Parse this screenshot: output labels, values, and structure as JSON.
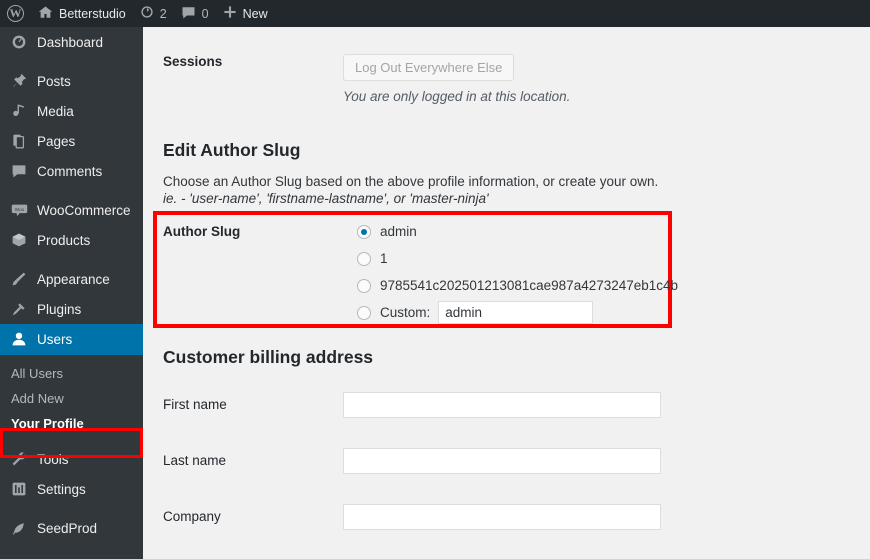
{
  "adminbar": {
    "logo_icon": "wordpress-logo-icon",
    "site_name": "Betterstudio",
    "home_icon": "home-icon",
    "updates_icon": "updates-icon",
    "updates_count": "2",
    "comments_icon": "comment-bubble-icon",
    "comments_count": "0",
    "new_icon": "plus-icon",
    "new_label": "New"
  },
  "sidebar": {
    "items": [
      {
        "label": "Dashboard",
        "icon": "dashboard-icon",
        "name": "sidebar-item-dashboard",
        "sep": false,
        "current": false
      },
      {
        "label": "Posts",
        "icon": "pin-icon",
        "name": "sidebar-item-posts",
        "sep": true,
        "current": false
      },
      {
        "label": "Media",
        "icon": "media-icon",
        "name": "sidebar-item-media",
        "sep": false,
        "current": false
      },
      {
        "label": "Pages",
        "icon": "pages-icon",
        "name": "sidebar-item-pages",
        "sep": false,
        "current": false
      },
      {
        "label": "Comments",
        "icon": "comment-bubble-icon",
        "name": "sidebar-item-comments",
        "sep": false,
        "current": false
      },
      {
        "label": "WooCommerce",
        "icon": "woocommerce-icon",
        "name": "sidebar-item-woocommerce",
        "sep": true,
        "current": false
      },
      {
        "label": "Products",
        "icon": "products-box-icon",
        "name": "sidebar-item-products",
        "sep": false,
        "current": false
      },
      {
        "label": "Appearance",
        "icon": "paintbrush-icon",
        "name": "sidebar-item-appearance",
        "sep": true,
        "current": false
      },
      {
        "label": "Plugins",
        "icon": "plug-icon",
        "name": "sidebar-item-plugins",
        "sep": false,
        "current": false
      },
      {
        "label": "Users",
        "icon": "user-icon",
        "name": "sidebar-item-users",
        "sep": false,
        "current": true
      }
    ],
    "submenu": [
      {
        "label": "All Users",
        "name": "submenu-item-all-users",
        "current": false
      },
      {
        "label": "Add New",
        "name": "submenu-item-add-new",
        "current": false
      },
      {
        "label": "Your Profile",
        "name": "submenu-item-your-profile",
        "current": true
      }
    ],
    "items_after": [
      {
        "label": "Tools",
        "icon": "wrench-icon",
        "name": "sidebar-item-tools",
        "sep": false,
        "current": false
      },
      {
        "label": "Settings",
        "icon": "settings-sliders-icon",
        "name": "sidebar-item-settings",
        "sep": false,
        "current": false
      },
      {
        "label": "SeedProd",
        "icon": "seedprod-icon",
        "name": "sidebar-item-seedprod",
        "sep": true,
        "current": false
      }
    ]
  },
  "main": {
    "sessions": {
      "label": "Sessions",
      "button_label": "Log Out Everywhere Else",
      "hint": "You are only logged in at this location."
    },
    "author_slug": {
      "heading": "Edit Author Slug",
      "desc_line1": "Choose an Author Slug based on the above profile information, or create your own.",
      "desc_line2": "ie. - 'user-name', 'firstname-lastname', or 'master-ninja'",
      "field_label": "Author Slug",
      "options": [
        {
          "label": "admin",
          "checked": true,
          "name": "radio-slug-admin"
        },
        {
          "label": "1",
          "checked": false,
          "name": "radio-slug-1"
        },
        {
          "label": "9785541c202501213081cae987a4273247eb1c4b",
          "checked": false,
          "name": "radio-slug-hash"
        }
      ],
      "custom": {
        "label": "Custom:",
        "checked": false,
        "value": "admin",
        "name": "radio-slug-custom"
      }
    },
    "billing": {
      "heading": "Customer billing address",
      "fields": [
        {
          "label": "First name",
          "value": "",
          "name": "billing-first-name-input"
        },
        {
          "label": "Last name",
          "value": "",
          "name": "billing-last-name-input"
        },
        {
          "label": "Company",
          "value": "",
          "name": "billing-company-input"
        }
      ]
    }
  },
  "colors": {
    "admin_bar": "#23282d",
    "sidebar": "#32373c",
    "accent_blue": "#0073aa",
    "content_bg": "#f1f1f1",
    "highlight_red": "#ff0000"
  }
}
